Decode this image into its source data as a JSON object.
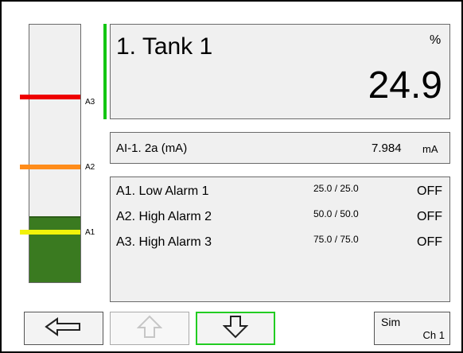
{
  "tank": {
    "title": "1. Tank 1",
    "unit": "%",
    "value": "24.9",
    "level_fraction": 0.249
  },
  "input": {
    "label": "AI-1. 2a (mA)",
    "value": "7.984",
    "unit": "mA"
  },
  "gauge_markers": [
    {
      "label": "A3",
      "color": "#ee0000"
    },
    {
      "label": "A2",
      "color": "#ff8c1a"
    },
    {
      "label": "A1",
      "color": "#f2f20a"
    }
  ],
  "alarms": [
    {
      "name": "A1. Low Alarm 1",
      "setpoint": "25.0 / 25.0",
      "state": "OFF"
    },
    {
      "name": "A2. High Alarm 2",
      "setpoint": "50.0 / 50.0",
      "state": "OFF"
    },
    {
      "name": "A3. High Alarm 3",
      "setpoint": "75.0 / 75.0",
      "state": "OFF"
    }
  ],
  "nav": {
    "back_icon": "left-arrow-icon",
    "up_icon": "up-arrow-icon",
    "down_icon": "down-arrow-icon",
    "active_color": "#22cc22"
  },
  "sim": {
    "label": "Sim",
    "channel": "Ch 1"
  }
}
